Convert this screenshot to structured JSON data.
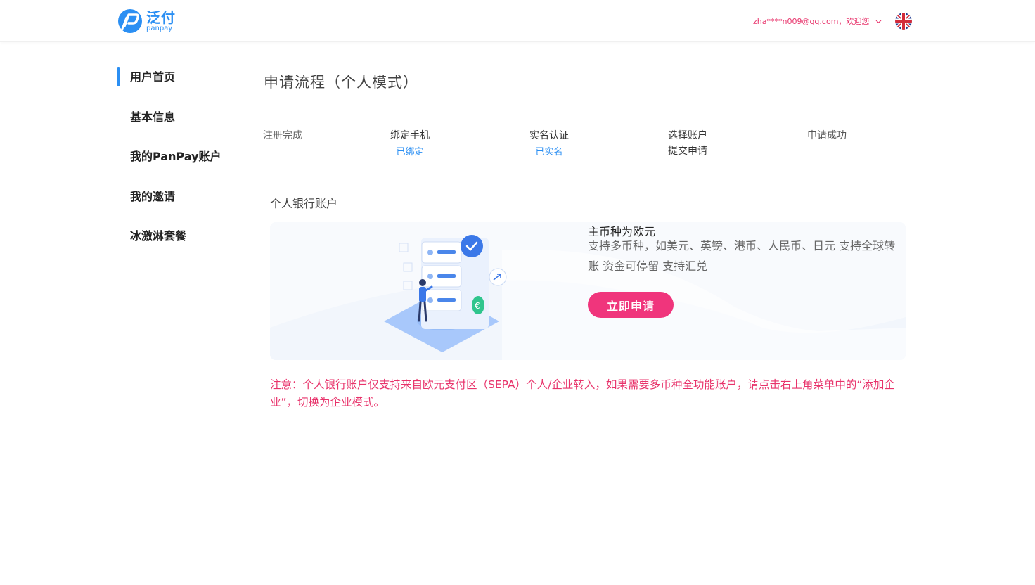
{
  "header": {
    "logo_cn": "泛付",
    "logo_en": "panpay",
    "account_label": "zha****n009@qq.com，欢迎您",
    "brand_color": "#2b8ff3",
    "accent_color": "#e8336b"
  },
  "sidebar": {
    "items": [
      {
        "label": "用户首页",
        "active": true
      },
      {
        "label": "基本信息",
        "active": false
      },
      {
        "label": "我的PanPay账户",
        "active": false
      },
      {
        "label": "我的邀请",
        "active": false
      },
      {
        "label": "冰激淋套餐",
        "active": false
      }
    ]
  },
  "main": {
    "title": "申请流程（个人模式）",
    "steps": [
      {
        "label": "注册完成",
        "sub": ""
      },
      {
        "label": "绑定手机",
        "sub": "已绑定"
      },
      {
        "label": "实名认证",
        "sub": "已实名"
      },
      {
        "label": "选择账户",
        "label2": "提交申请",
        "sub": ""
      },
      {
        "label": "申请成功",
        "sub": ""
      }
    ],
    "section_title": "个人银行账户",
    "card": {
      "heading": "主币种为欧元",
      "description": "支持多币种，如美元、英镑、港币、人民币、日元 支持全球转账 资金可停留 支持汇兑",
      "button_label": "立即申请",
      "button_color": "#f0357c"
    },
    "notice": "注意：个人银行账户仅支持来自欧元支付区（SEPA）个人/企业转入，如果需要多币种全功能账户，请点击右上角菜单中的“添加企业”，切换为企业模式。"
  }
}
